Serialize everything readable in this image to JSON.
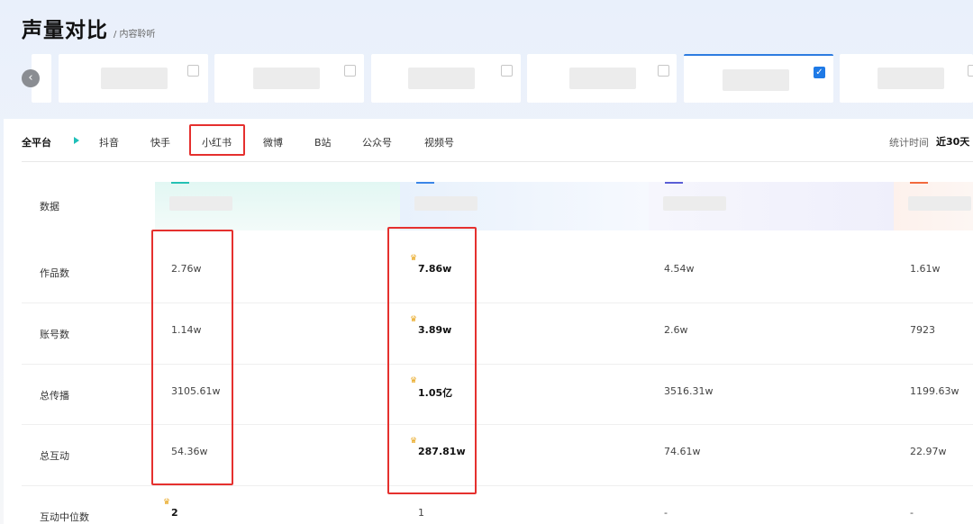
{
  "header": {
    "title": "声量对比",
    "breadcrumb": "/ 内容聆听"
  },
  "cards": [
    {
      "selected": false
    },
    {
      "selected": false
    },
    {
      "selected": false
    },
    {
      "selected": false
    },
    {
      "selected": true,
      "check": "✓"
    },
    {
      "selected": false
    }
  ],
  "nav": {
    "prev_icon": "‹"
  },
  "platform_tabs": [
    "全平台",
    "抖音",
    "快手",
    "小红书",
    "微博",
    "B站",
    "公众号",
    "视频号"
  ],
  "stat": {
    "label": "统计时间",
    "value": "近30天"
  },
  "table": {
    "header_label": "数据",
    "column_colors": [
      "#25c1b4",
      "#3b86e8",
      "#5a5fd6",
      "#f26a3d"
    ],
    "rows": [
      {
        "label": "作品数",
        "values": [
          "2.76w",
          "7.86w",
          "4.54w",
          "1.61w"
        ],
        "winner": 1
      },
      {
        "label": "账号数",
        "values": [
          "1.14w",
          "3.89w",
          "2.6w",
          "7923"
        ],
        "winner": 1
      },
      {
        "label": "总传播",
        "values": [
          "3105.61w",
          "1.05亿",
          "3516.31w",
          "1199.63w"
        ],
        "winner": 1
      },
      {
        "label": "总互动",
        "values": [
          "54.36w",
          "287.81w",
          "74.61w",
          "22.97w"
        ],
        "winner": 1
      },
      {
        "label": "互动中位数",
        "values": [
          "2",
          "1",
          "-",
          "-"
        ],
        "winner": 0
      }
    ]
  },
  "icons": {
    "crown": "crown-icon",
    "prev": "chevron-left-icon",
    "active_tab_marker": "triangle-right-icon"
  }
}
